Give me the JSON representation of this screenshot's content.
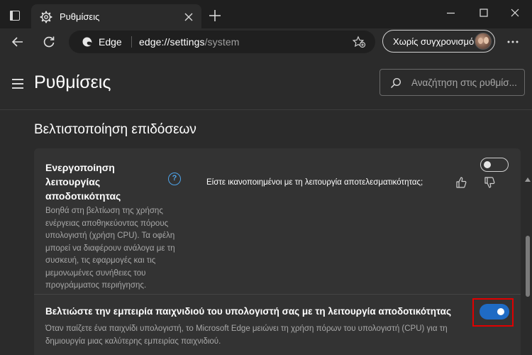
{
  "browser": {
    "tab_title": "Ρυθμίσεις",
    "edge_label": "Edge",
    "url_host": "edge://settings",
    "url_path": "/system",
    "profile_label": "Χωρίς συγχρονισμό"
  },
  "settings": {
    "page_title": "Ρυθμίσεις",
    "search_placeholder": "Αναζήτηση στις ρυθμίσ...",
    "section_title": "Βελτιστοποίηση επιδόσεων",
    "efficiency_mode": {
      "title": "Ενεργοποίηση λειτουργίας αποδοτικότητας",
      "help": "?",
      "description": "Βοηθά στη βελτίωση της χρήσης ενέργειας αποθηκεύοντας πόρους υπολογιστή (χρήση CPU). Τα οφέλη μπορεί να διαφέρουν ανάλογα με τη συσκευή, τις εφαρμογές και τις μεμονωμένες συνήθειες του προγράμματος περιήγησης.",
      "feedback_question": "Είστε ικανοποιημένοι με τη λειτουργία αποτελεσματικότητας;",
      "enabled": false
    },
    "gaming": {
      "title": "Βελτιώστε την εμπειρία παιχνιδιού του υπολογιστή σας με τη λειτουργία αποδοτικότητας",
      "description": "Όταν παίζετε ένα παιχνίδι υπολογιστή, το Microsoft Edge μειώνει τη χρήση πόρων του υπολογιστή (CPU) για τη δημιουργία μιας καλύτερης εμπειρίας παιχνιδιού.",
      "enabled": true
    }
  },
  "colors": {
    "accent": "#1f6bc4",
    "highlight": "#e00000",
    "help_icon": "#4ea3e8"
  }
}
